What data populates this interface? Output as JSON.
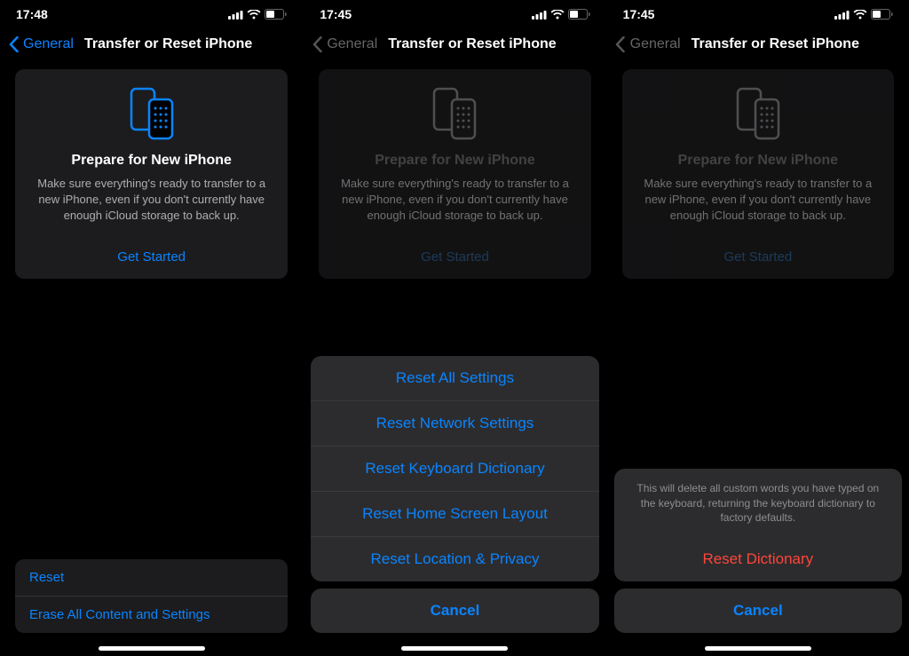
{
  "screens": [
    {
      "time": "17:48",
      "back_active": true,
      "back_label": "General",
      "nav_title": "Transfer or Reset iPhone",
      "card": {
        "title": "Prepare for New iPhone",
        "body": "Make sure everything's ready to transfer to a new iPhone, even if you don't currently have enough iCloud storage to back up.",
        "action": "Get Started"
      },
      "bottom_list": [
        "Reset",
        "Erase All Content and Settings"
      ]
    },
    {
      "time": "17:45",
      "back_active": false,
      "back_label": "General",
      "nav_title": "Transfer or Reset iPhone",
      "card": {
        "title": "Prepare for New iPhone",
        "body": "Make sure everything's ready to transfer to a new iPhone, even if you don't currently have enough iCloud storage to back up.",
        "action": "Get Started"
      },
      "sheet": {
        "options": [
          "Reset All Settings",
          "Reset Network Settings",
          "Reset Keyboard Dictionary",
          "Reset Home Screen Layout",
          "Reset Location & Privacy"
        ],
        "cancel": "Cancel"
      }
    },
    {
      "time": "17:45",
      "back_active": false,
      "back_label": "General",
      "nav_title": "Transfer or Reset iPhone",
      "card": {
        "title": "Prepare for New iPhone",
        "body": "Make sure everything's ready to transfer to a new iPhone, even if you don't currently have enough iCloud storage to back up.",
        "action": "Get Started"
      },
      "confirm": {
        "message": "This will delete all custom words you have typed on the keyboard, returning the keyboard dictionary to factory defaults.",
        "destructive": "Reset Dictionary",
        "cancel": "Cancel"
      }
    }
  ]
}
